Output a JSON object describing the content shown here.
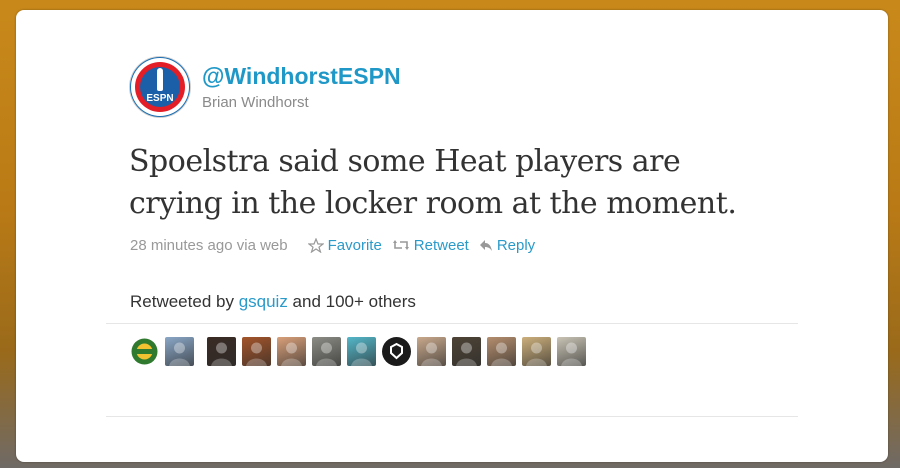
{
  "tweet": {
    "screen_name": "@WindhorstESPN",
    "real_name": "Brian Windhorst",
    "text_lines": [
      "Spoelstra said some Heat players are",
      "crying in the locker room at the moment."
    ],
    "timestamp": "28 minutes ago via web",
    "favorite_label": "Favorite",
    "retweet_label": "Retweet",
    "reply_label": "Reply",
    "avatar_text": "ESPN"
  },
  "retweets": {
    "prefix": "Retweeted by ",
    "user": "gsquiz",
    "suffix": " and 100+ others",
    "avatars": [
      {
        "icon": "sonics-logo-avatar",
        "color": "#2f7a2f"
      },
      {
        "icon": "person-avatar",
        "color": "#8aa7c7"
      },
      {
        "icon": "dark-photo-avatar",
        "color": "#3a2b24"
      },
      {
        "icon": "band-photo-avatar",
        "color": "#a4552a"
      },
      {
        "icon": "person-avatar",
        "color": "#d9a07a"
      },
      {
        "icon": "car-photo-avatar",
        "color": "#8d8d86"
      },
      {
        "icon": "cartoon-avatar",
        "color": "#54b7c9"
      },
      {
        "icon": "badge-logo-avatar",
        "color": "#1b1b1b"
      },
      {
        "icon": "person-avatar",
        "color": "#c9a98c"
      },
      {
        "icon": "night-photo-avatar",
        "color": "#4e4436"
      },
      {
        "icon": "person-avatar",
        "color": "#b58e6e"
      },
      {
        "icon": "room-photo-avatar",
        "color": "#cdb07c"
      },
      {
        "icon": "football-player-avatar",
        "color": "#c9c4b5"
      }
    ]
  },
  "colors": {
    "link": "#2a9ac9",
    "screen_name": "#1f98c7",
    "text": "#333333",
    "muted": "#999999"
  }
}
